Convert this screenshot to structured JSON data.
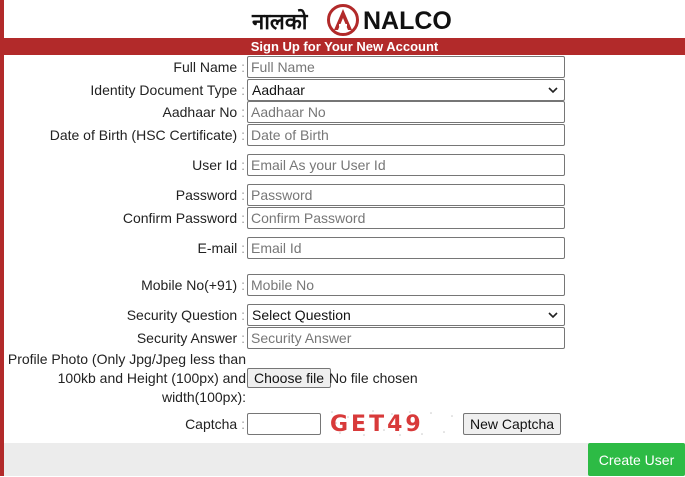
{
  "header": {
    "logo_hindi": "नालको",
    "logo_english": "NALCO",
    "banner": "Sign Up for Your New Account"
  },
  "colors": {
    "brand_red": "#b22a2a",
    "create_green": "#2dbb45"
  },
  "form": {
    "full_name": {
      "label": "Full Name",
      "placeholder": "Full Name"
    },
    "id_doc_type": {
      "label": "Identity Document Type",
      "value": "Aadhaar"
    },
    "aadhaar": {
      "label": "Aadhaar No",
      "placeholder": "Aadhaar No"
    },
    "dob": {
      "label": "Date of Birth (HSC Certificate)",
      "placeholder": "Date of Birth"
    },
    "user_id": {
      "label": "User Id",
      "placeholder": "Email As your User Id"
    },
    "password": {
      "label": "Password",
      "placeholder": "Password"
    },
    "confirm_password": {
      "label": "Confirm Password",
      "placeholder": "Confirm Password"
    },
    "email": {
      "label": "E-mail",
      "placeholder": "Email Id"
    },
    "mobile": {
      "label": "Mobile No(+91)",
      "placeholder": "Mobile No"
    },
    "security_question": {
      "label": "Security Question",
      "value": "Select Question"
    },
    "security_answer": {
      "label": "Security Answer",
      "placeholder": "Security Answer"
    },
    "photo": {
      "label_line1": "Profile Photo (Only Jpg/Jpeg less than",
      "label_line2": "100kb and Height (100px) and",
      "label_line3": "width(100px):",
      "choose_label": "Choose file",
      "status": "No file chosen"
    },
    "captcha": {
      "label": "Captcha",
      "text": "GET49",
      "new_label": "New Captcha"
    }
  },
  "actions": {
    "create_user": "Create User"
  }
}
